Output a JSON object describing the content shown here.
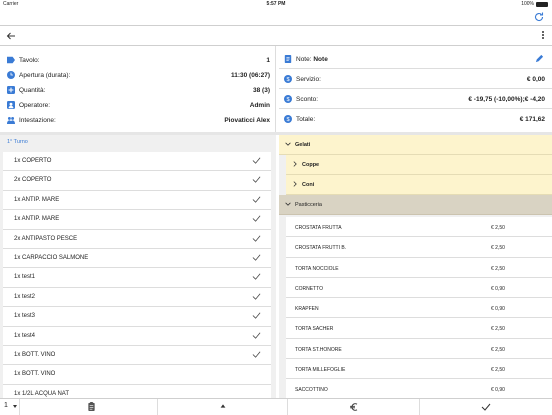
{
  "status": {
    "carrier": "Carrier",
    "time": "5:57 PM",
    "battery": "100%"
  },
  "info": {
    "tavolo_label": "Tavolo:",
    "tavolo_value": "1",
    "apertura_label": "Apertura (durata):",
    "apertura_value": "11:30 (06:27)",
    "quantita_label": "Quantità:",
    "quantita_value": "38 (3)",
    "operatore_label": "Operatore:",
    "operatore_value": "Admin",
    "intestazione_label": "Intestazione:",
    "intestazione_value": "Piovaticci Alex"
  },
  "summary": {
    "note_label": "Note:",
    "note_value": "Note",
    "servizio_label": "Servizio:",
    "servizio_value": "€ 0,00",
    "sconto_label": "Sconto:",
    "sconto_value": "€ -19,75 (-10,00%);€ -4,20",
    "totale_label": "Totale:",
    "totale_value": "€ 171,62"
  },
  "turno_label": "1° Turno",
  "orders": [
    "1x COPERTO",
    "2x COPERTO",
    "1x ANTIP. MARE",
    "1x ANTIP. MARE",
    "2x ANTIPASTO PESCE",
    "1x CARPACCIO SALMONE",
    "1x test1",
    "1x test2",
    "1x test3",
    "1x test4",
    "1x BOTT. VINO",
    "1x BOTT. VINO",
    "1x 1/2L ACQUA NAT"
  ],
  "categories": {
    "gelati": "Gelati",
    "coppe": "Coppe",
    "coni": "Coni",
    "pasticceria": "Pasticceria"
  },
  "products": [
    {
      "name": "CROSTATA FRUTTA",
      "price": "€ 2,50"
    },
    {
      "name": "CROSTATA FRUTTI B.",
      "price": "€ 2,50"
    },
    {
      "name": "TORTA NOCCIOLE",
      "price": "€ 2,50"
    },
    {
      "name": "CORNETTO",
      "price": "€ 0,90"
    },
    {
      "name": "KRAPFEN",
      "price": "€ 0,90"
    },
    {
      "name": "TORTA SACHER",
      "price": "€ 2,50"
    },
    {
      "name": "TORTA ST.HONORE",
      "price": "€ 2,50"
    },
    {
      "name": "TORTA MILLEFOGLIE",
      "price": "€ 2,50"
    },
    {
      "name": "SACCOTTINO",
      "price": "€ 0,90"
    }
  ],
  "bottom": {
    "turn_value": "1"
  },
  "colors": {
    "accent": "#3a7bd5",
    "category_bg": "#fdf4cd",
    "active_category_bg": "#d9d3c3"
  }
}
